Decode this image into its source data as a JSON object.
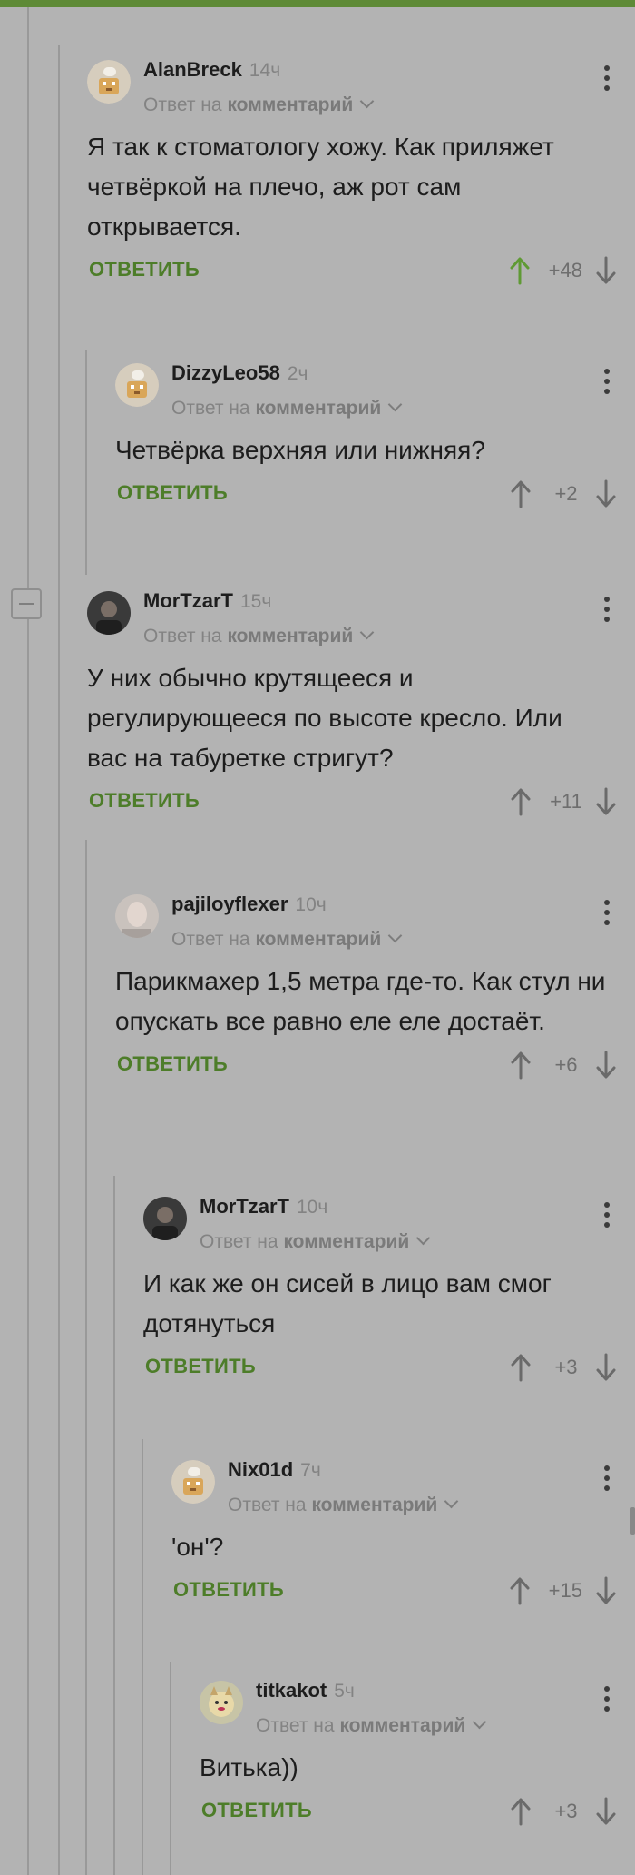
{
  "thread": {
    "reply_prefix": "Ответ на",
    "reply_target": "комментарий",
    "reply_label": "ОТВЕТИТЬ"
  },
  "comments": [
    {
      "author": "AlanBreck",
      "time": "14ч",
      "text": "Я так к стоматологу хожу. Как приляжет четвёркой на плечо, аж рот сам открывается.",
      "score": "+48",
      "upvoted": true,
      "avatar": "default"
    },
    {
      "author": "DizzyLeo58",
      "time": "2ч",
      "text": "Четвёрка верхняя или нижняя?",
      "score": "+2",
      "upvoted": false,
      "avatar": "default"
    },
    {
      "author": "MorTzarT",
      "time": "15ч",
      "text": "У них обычно крутящееся и регулирующееся  по высоте кресло. Или вас на табуретке стригут?",
      "score": "+11",
      "upvoted": false,
      "avatar": "photo-dark"
    },
    {
      "author": "pajiloyflexer",
      "time": "10ч",
      "text": "Парикмахер 1,5 метра где-то. Как стул ни опускать все равно еле еле достаёт.",
      "score": "+6",
      "upvoted": false,
      "avatar": "photo-face"
    },
    {
      "author": "MorTzarT",
      "time": "10ч",
      "text": "И как же он сисей в лицо вам смог дотянуться",
      "score": "+3",
      "upvoted": false,
      "avatar": "photo-dark"
    },
    {
      "author": "Nix01d",
      "time": "7ч",
      "text": "'он'?",
      "score": "+15",
      "upvoted": false,
      "avatar": "default"
    },
    {
      "author": "titkakot",
      "time": "5ч",
      "text": "Витька))",
      "score": "+3",
      "upvoted": false,
      "avatar": "cat"
    }
  ],
  "colors": {
    "accent": "#4d7d29",
    "upvoted": "#5f9a34",
    "background": "#b3b3b3"
  }
}
